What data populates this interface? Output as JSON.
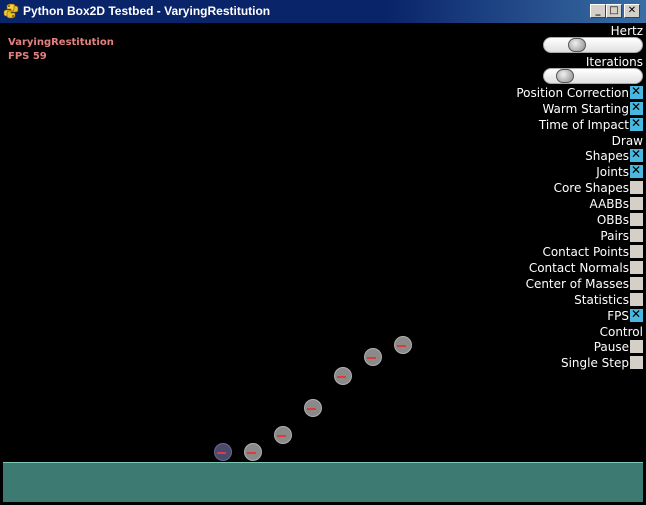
{
  "window": {
    "title": "Python Box2D Testbed - VaryingRestitution",
    "icon": "python-icon",
    "buttons": {
      "minimize": "_",
      "maximize": "□",
      "close": "✕"
    }
  },
  "scene": {
    "name": "VaryingRestitution",
    "fps": "FPS 59"
  },
  "sliders": {
    "hertz": {
      "label": "Hertz",
      "value": 0.3
    },
    "iterations": {
      "label": "Iterations",
      "value": 0.15
    }
  },
  "settings": [
    {
      "label": "Position Correction",
      "checked": true
    },
    {
      "label": "Warm Starting",
      "checked": true
    },
    {
      "label": "Time of Impact",
      "checked": true
    }
  ],
  "draw_header": "Draw",
  "draw": [
    {
      "label": "Shapes",
      "checked": true
    },
    {
      "label": "Joints",
      "checked": true
    },
    {
      "label": "Core Shapes",
      "checked": false
    },
    {
      "label": "AABBs",
      "checked": false
    },
    {
      "label": "OBBs",
      "checked": false
    },
    {
      "label": "Pairs",
      "checked": false
    },
    {
      "label": "Contact Points",
      "checked": false
    },
    {
      "label": "Contact Normals",
      "checked": false
    },
    {
      "label": "Center of Masses",
      "checked": false
    },
    {
      "label": "Statistics",
      "checked": false
    },
    {
      "label": "FPS",
      "checked": true
    }
  ],
  "control_header": "Control",
  "control": [
    {
      "label": "Pause",
      "checked": false
    },
    {
      "label": "Single Step",
      "checked": false
    }
  ],
  "colors": {
    "ground": "#3d7a72",
    "ball": "#8a8a8a",
    "ball_sleeping": "#4a4a6e",
    "radius_line": "#e23a3a"
  }
}
